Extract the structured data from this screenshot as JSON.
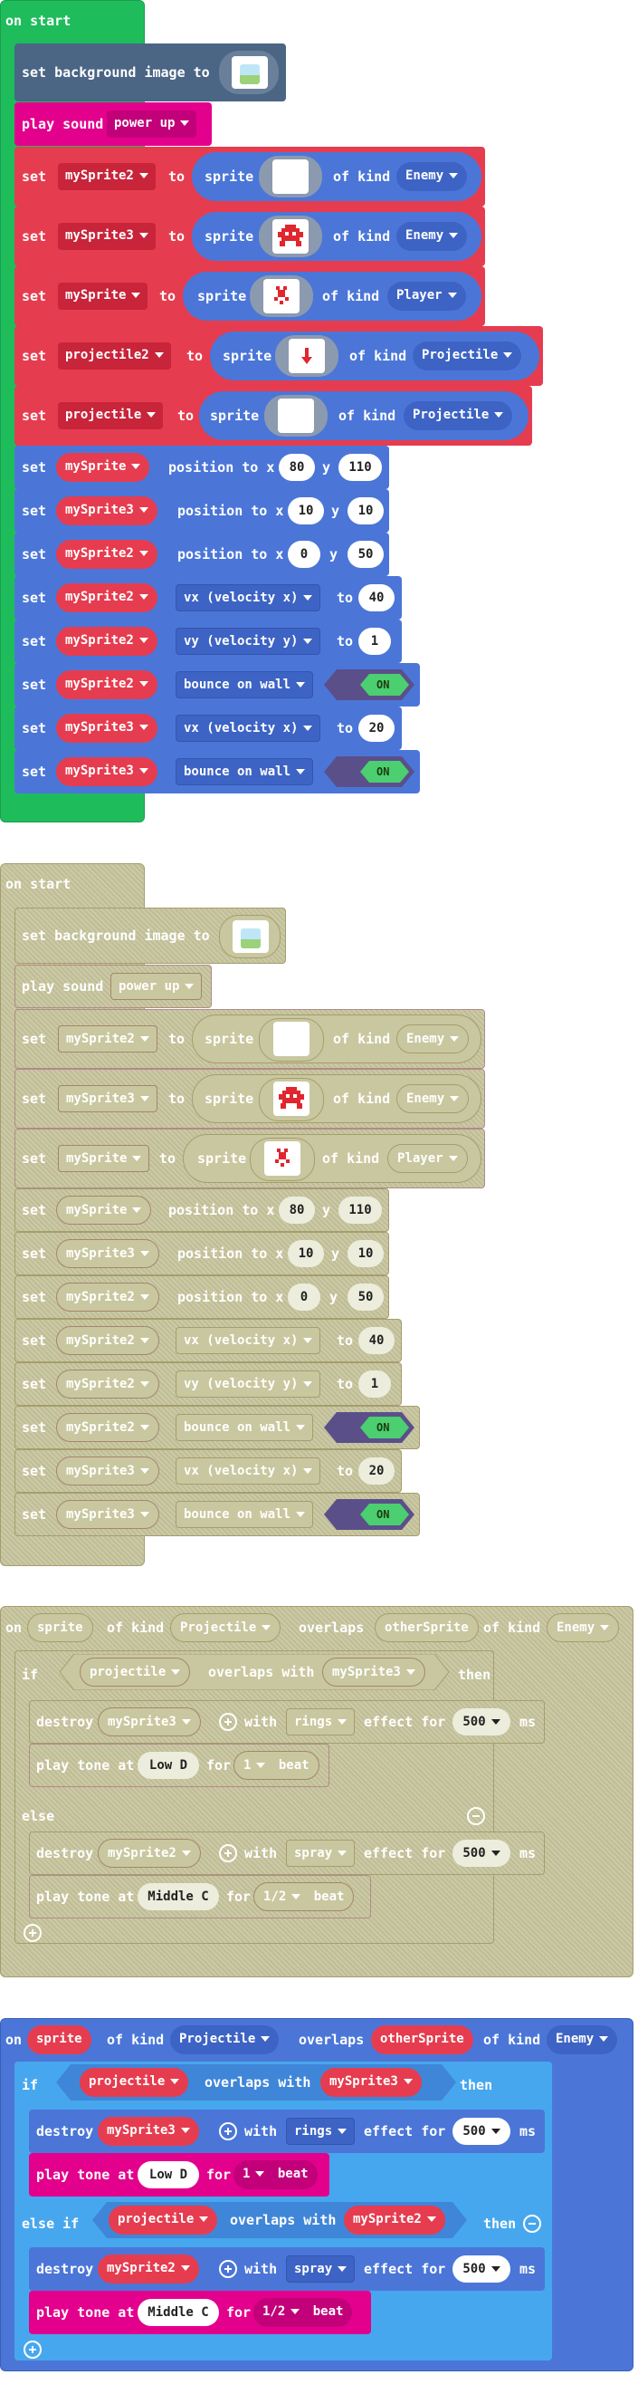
{
  "colors": {
    "on_start_green": "#1fbc5c",
    "sprites_red": "#e63c4f",
    "sprites_blue": "#4b76d8",
    "background_dark": "#4b6584",
    "music_magenta": "#e3008c",
    "toggle_green": "#4bcf70",
    "toggle_dark": "#5b4f8a",
    "disabled_khaki": "#c9c79f",
    "disabled_border": "#a59e6d",
    "if_blue": "#47a7ee",
    "event_blue": "#4b76d8"
  },
  "labels": {
    "on_start": "on start",
    "set_background_image_to": "set background image to",
    "play_sound": "play sound",
    "set": "set",
    "to": "to",
    "sprite": "sprite",
    "of_kind": "of kind",
    "position_to_x": "position to x",
    "y": "y",
    "on": "on",
    "overlaps": "overlaps",
    "if": "if",
    "then": "then",
    "overlaps_with": "overlaps with",
    "destroy": "destroy",
    "with": "with",
    "effect_for": "effect for",
    "ms": "ms",
    "play_tone_at": "play tone at",
    "for": "for",
    "else": "else",
    "else_if": "else if",
    "on_toggle": "ON"
  },
  "sound_name": "power up",
  "vars": {
    "mySprite": "mySprite",
    "mySprite2": "mySprite2",
    "mySprite3": "mySprite3",
    "projectile": "projectile",
    "projectile2": "projectile2",
    "sprite": "sprite",
    "otherSprite": "otherSprite"
  },
  "kinds": {
    "enemy": "Enemy",
    "player": "Player",
    "projectile": "Projectile"
  },
  "props": {
    "vx": "vx (velocity x)",
    "vy": "vy (velocity y)",
    "bounce": "bounce on wall"
  },
  "values": {
    "ms_x": "80",
    "ms_y": "110",
    "ms3_x": "10",
    "ms3_y": "10",
    "ms2_x": "0",
    "ms2_y": "50",
    "ms2_vx": "40",
    "ms2_vy": "1",
    "ms3_vx": "20",
    "duration_ms": "500",
    "one_beat": "1",
    "half_beat": "1/2",
    "beat": "beat"
  },
  "effects": {
    "rings": "rings",
    "spray": "spray"
  },
  "notes": {
    "low_d": "Low D",
    "middle_c": "Middle C"
  }
}
